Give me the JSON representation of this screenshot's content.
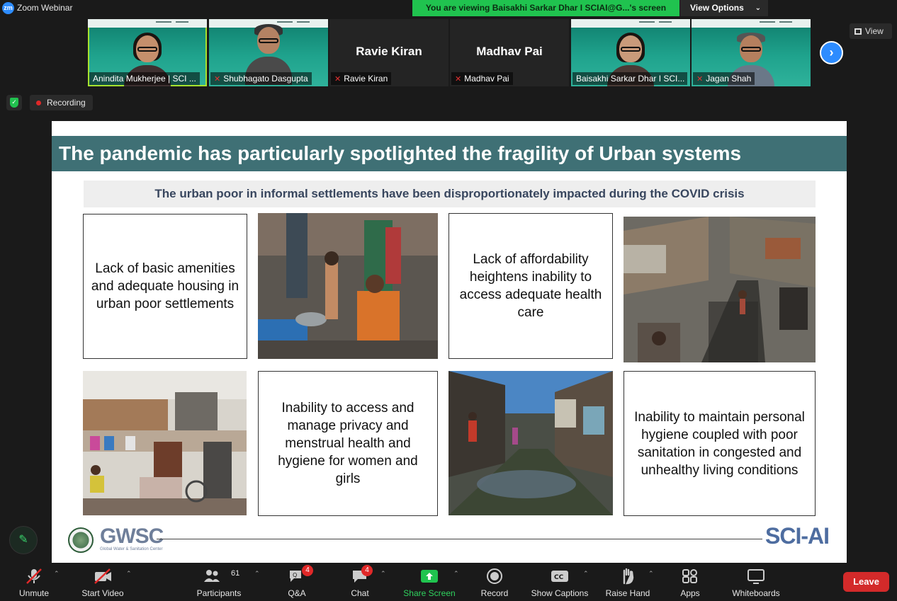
{
  "window": {
    "app_title": "Zoom Webinar",
    "logo_text": "zm",
    "share_banner": "You are viewing Baisakhi Sarkar Dhar I SCIAI@G...'s screen",
    "view_options": "View Options"
  },
  "participants_strip": [
    {
      "name": "Anindita Mukherjee | SCI ...",
      "has_video": true,
      "muted": false,
      "active": true
    },
    {
      "name": "Shubhagato Dasgupta",
      "has_video": true,
      "muted": true,
      "active": false
    },
    {
      "name": "Ravie Kiran",
      "big_name": "Ravie Kiran",
      "has_video": false,
      "muted": true
    },
    {
      "name": "Madhav Pai",
      "big_name": "Madhav Pai",
      "has_video": false,
      "muted": true
    },
    {
      "name": "Baisakhi Sarkar Dhar I SCI...",
      "has_video": true,
      "muted": false
    },
    {
      "name": "Jagan Shah",
      "has_video": true,
      "muted": true
    }
  ],
  "view_button": "View",
  "recording_label": "Recording",
  "slide": {
    "title": "The pandemic has particularly spotlighted the fragility of Urban systems",
    "subtitle": "The urban poor in informal settlements have been disproportionately impacted during the COVID crisis",
    "boxes": [
      "Lack of basic amenities and adequate housing in urban poor settlements",
      "Lack of affordability heightens inability to access adequate health care",
      "Inability to access and manage privacy and menstrual health and hygiene for women and girls",
      "Inability to maintain personal hygiene coupled with poor sanitation in congested and unhealthy living conditions"
    ],
    "footer_left": "GWSC",
    "footer_left_sub": "Global Water & Sanitation Center",
    "footer_right": "SCI-AI"
  },
  "toolbar": {
    "unmute": "Unmute",
    "start_video": "Start Video",
    "participants": "Participants",
    "participants_count": "61",
    "qa": "Q&A",
    "qa_badge": "4",
    "chat": "Chat",
    "chat_badge": "4",
    "share_screen": "Share Screen",
    "record": "Record",
    "captions": "Show Captions",
    "raise_hand": "Raise Hand",
    "apps": "Apps",
    "whiteboards": "Whiteboards",
    "leave": "Leave"
  },
  "colors": {
    "share_green": "#20c34f",
    "slide_title_bg": "#3f7075",
    "accent_blue": "#2d8cff",
    "leave_red": "#d32a2a"
  }
}
